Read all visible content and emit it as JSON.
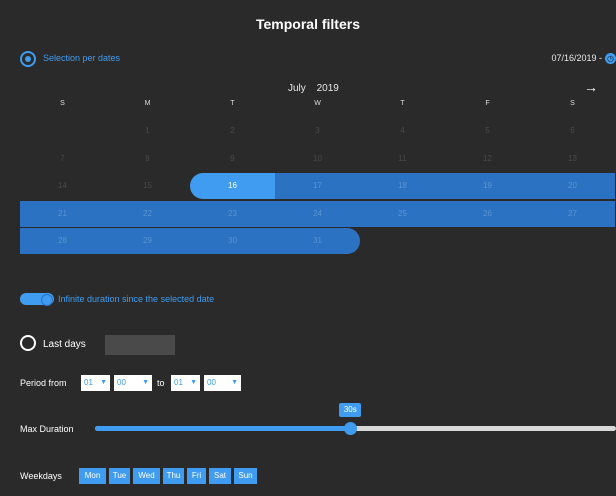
{
  "title": "Temporal filters",
  "selection": {
    "label": "Selection per dates",
    "selected": true,
    "date": "07/16/2019 -",
    "date_icon": "clock-icon"
  },
  "calendar": {
    "month": "July",
    "year": "2019",
    "next_icon": "arrow-right-icon",
    "weekdays": [
      "S",
      "M",
      "T",
      "W",
      "T",
      "F",
      "S"
    ],
    "weeks": [
      [
        "",
        "1",
        "2",
        "3",
        "4",
        "5",
        "6"
      ],
      [
        "7",
        "8",
        "9",
        "10",
        "11",
        "12",
        "13"
      ],
      [
        "14",
        "15",
        "16",
        "17",
        "18",
        "19",
        "20"
      ],
      [
        "21",
        "22",
        "23",
        "24",
        "25",
        "26",
        "27"
      ],
      [
        "28",
        "29",
        "30",
        "31",
        "",
        "",
        ""
      ]
    ],
    "range_start": "16",
    "range_end": "31"
  },
  "infinite": {
    "label": "Infinite duration since the selected date",
    "on": true
  },
  "last_days": {
    "label": "Last days",
    "selected": false,
    "value": ""
  },
  "period": {
    "from_label": "Period from",
    "to_label": "to",
    "from_hour": "01",
    "from_min": "00",
    "to_hour": "01",
    "to_min": "00"
  },
  "max_duration": {
    "label": "Max Duration",
    "tooltip": "30s",
    "level": 0.49
  },
  "weekdays": {
    "label": "Weekdays",
    "days": [
      "Mon",
      "Tue",
      "Wed",
      "Thu",
      "Fri",
      "Sat",
      "Sun"
    ]
  },
  "colors": {
    "accent": "#3f9cf0",
    "range": "#2b73c2",
    "background": "#2a2a2a"
  }
}
